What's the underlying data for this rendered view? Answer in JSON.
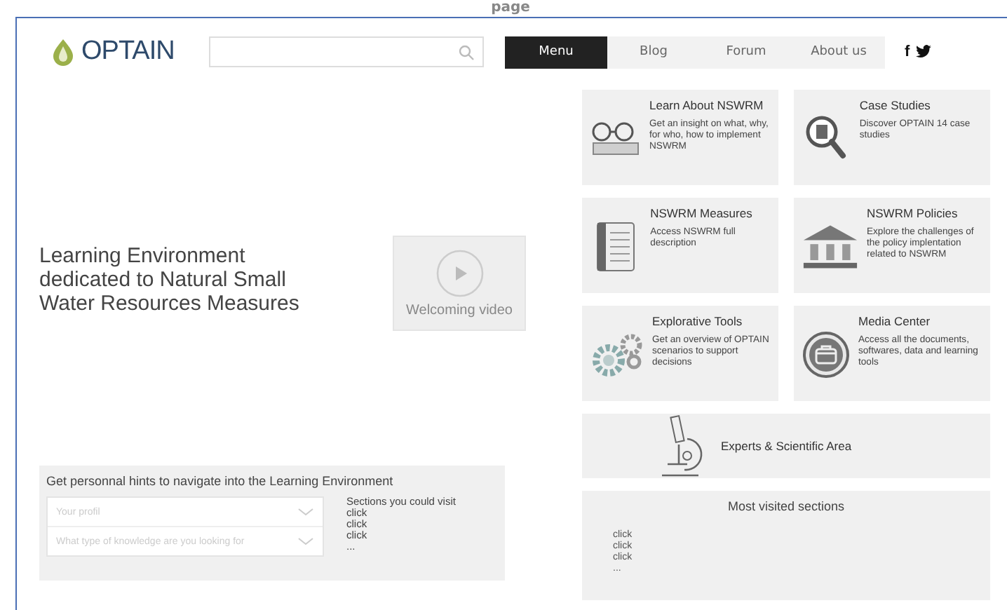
{
  "page_label": "page",
  "header": {
    "logo": "OPTAIN",
    "nav": [
      {
        "label": "Menu",
        "selected": true
      },
      {
        "label": "Blog",
        "selected": false
      },
      {
        "label": "Forum",
        "selected": false
      },
      {
        "label": "About us",
        "selected": false
      }
    ],
    "social": [
      "f"
    ]
  },
  "intro": {
    "title": "Learning Environment dedicated to Natural Small Water Resources Measures",
    "video_label": "Welcoming video"
  },
  "tiles": [
    {
      "kind": "card",
      "title": "Learn About NSWRM",
      "text": "Get an insight on what, why, for who, how to implement NSWRM"
    },
    {
      "kind": "card",
      "title": "Case Studies",
      "text": "Discover OPTAIN 14 case studies"
    },
    {
      "kind": "card",
      "title": "NSWRM Measures",
      "text": "Access NSWRM full description"
    },
    {
      "kind": "card",
      "title": "NSWRM Policies",
      "text": "Explore the challenges of the policy implentation related to NSWRM"
    },
    {
      "kind": "card",
      "title": "Explorative Tools",
      "text": "Get an overview of OPTAIN scenarios to support decisions"
    },
    {
      "kind": "card",
      "title": "Media Center",
      "text": "Access all the documents, softwares, data and learning tools"
    },
    {
      "kind": "banner",
      "title": "Experts & Scientific Area"
    }
  ],
  "hints": {
    "title": "Get personnal hints to navigate into the Learning Environment",
    "dropdowns": [
      {
        "placeholder": "Your profil"
      },
      {
        "placeholder": "What type of knowledge are you looking for"
      }
    ],
    "sections_title": "Sections you could visit",
    "links": [
      "click",
      "click",
      "click",
      "..."
    ]
  },
  "most_visited": {
    "title": "Most visited sections",
    "links": [
      "click",
      "click",
      "click",
      "..."
    ]
  }
}
